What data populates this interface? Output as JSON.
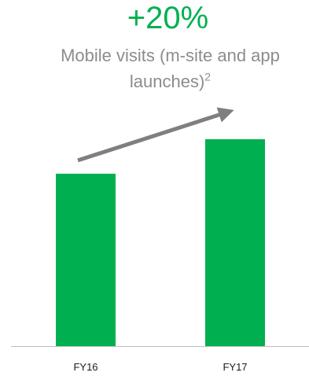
{
  "colors": {
    "accent": "#00b050",
    "subtitle": "#8c8c8c",
    "arrow": "#7f7f7f",
    "axis": "#bfbfbf"
  },
  "header": {
    "growth": "+20%",
    "subtitle": "Mobile visits (m-site and app launches)",
    "footnote": "2"
  },
  "chart_data": {
    "type": "bar",
    "categories": [
      "FY16",
      "FY17"
    ],
    "values": [
      100,
      120
    ],
    "title": "Mobile visits (m-site and app launches)",
    "xlabel": "",
    "ylabel": "",
    "ylim": [
      0,
      120
    ],
    "grid": false,
    "legend": "none",
    "annotation": "+20%"
  }
}
